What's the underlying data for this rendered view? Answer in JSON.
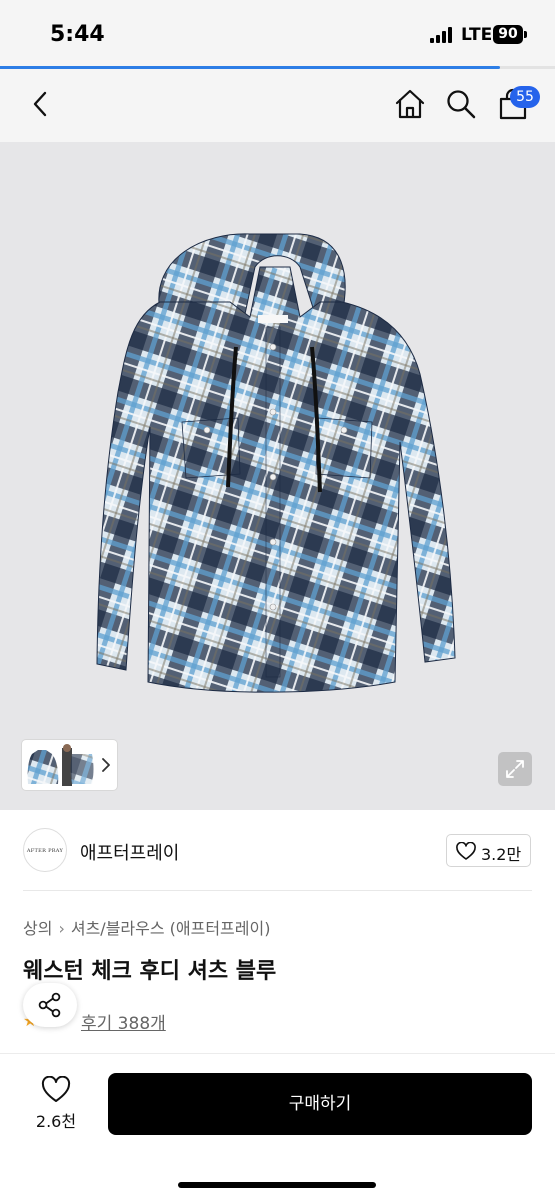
{
  "status_bar": {
    "time": "5:44",
    "network": "LTE",
    "battery": "90"
  },
  "page_load_progress_percent": 90,
  "nav": {
    "back_icon": "chevron-left-icon",
    "home_icon": "home-icon",
    "search_icon": "search-icon",
    "cart_icon": "shopping-bag-icon",
    "cart_count": "55"
  },
  "gallery": {
    "image": "blue plaid hooded shirt",
    "thumb_icon": "chevron-right-icon",
    "expand_icon": "expand-icon"
  },
  "brand": {
    "logo_text": "AFTER PRAY",
    "name": "애프터프레이",
    "like_count": "3.2만"
  },
  "breadcrumb": {
    "category": "상의",
    "subcategory": "셔츠/블라우스 (애프터프레이)"
  },
  "product": {
    "title": "웨스턴 체크 후디 셔츠 블루",
    "review_link": "후기 388개"
  },
  "bottom_bar": {
    "wish_count": "2.6천",
    "buy_label": "구매하기"
  },
  "colors": {
    "accent": "#2563eb",
    "primary_button": "#000000",
    "plaid_navy": "#17233a",
    "plaid_blue": "#5fa0d0"
  }
}
